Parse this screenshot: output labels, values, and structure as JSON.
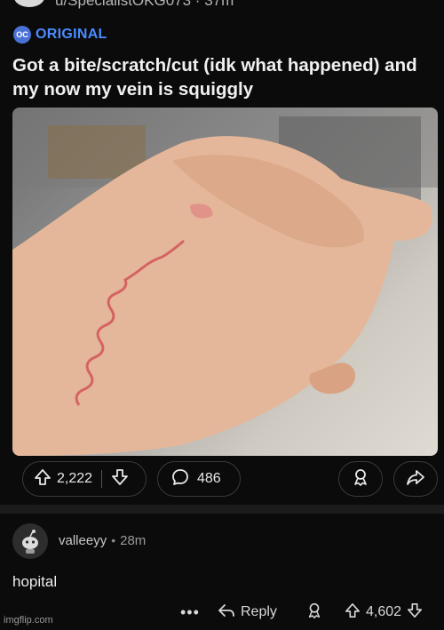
{
  "post": {
    "author_cut": "u/SpecialistOKG073 · 37m",
    "oc_badge": "OC",
    "flair": "ORIGINAL",
    "title": "Got a bite/scratch/cut (idk what happened) and my now my vein is squiggly",
    "upvotes": "2,222",
    "comments": "486"
  },
  "comment": {
    "username": "valleeyy",
    "separator": "•",
    "time": "28m",
    "body": "hopital",
    "more": "•••",
    "reply_label": "Reply",
    "votes": "4,602"
  },
  "watermark": "imgflip.com",
  "colors": {
    "background": "#0b0b0b",
    "flair": "#4a8cff",
    "oc_badge": "#4a72d6",
    "text": "#e8e8e8"
  },
  "icons": [
    "upvote-icon",
    "downvote-icon",
    "comment-icon",
    "award-icon",
    "share-icon",
    "reply-icon"
  ]
}
